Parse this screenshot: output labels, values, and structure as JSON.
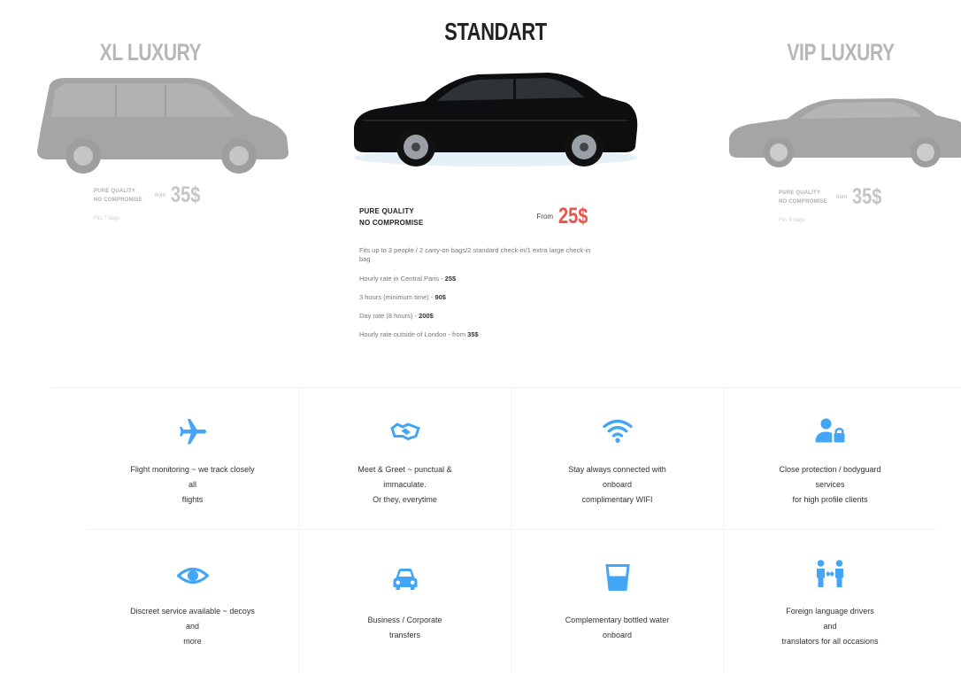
{
  "carousel": {
    "left": {
      "title": "XL LUXURY",
      "quality_line1": "PURE QUALITY",
      "quality_line2": "NO COMPROMISE",
      "from": "from",
      "price": "35$",
      "sub": "Fits 7 bags"
    },
    "center": {
      "title": "STANDART",
      "quality_line1": "PURE QUALITY",
      "quality_line2": "NO COMPROMISE",
      "from": "From",
      "price": "25$",
      "description": "Fits up to 3 people / 2 carry-on bags/2 standard check-in/1 extra large check-in bag",
      "rates": [
        {
          "label": "Hourly rate in Central Paris - ",
          "value": "25$"
        },
        {
          "label": "3 hours (minimum time) - ",
          "value": "90$"
        },
        {
          "label": "Day rate (8 hours) - ",
          "value": "200$"
        },
        {
          "label": "Hourly rate outside of London - from ",
          "value": "35$"
        }
      ]
    },
    "right": {
      "title": "VIP LUXURY",
      "quality_line1": "PURE QUALITY",
      "quality_line2": "NO COMPROMISE",
      "from": "from",
      "price": "35$",
      "sub": "Fits 3 bags"
    }
  },
  "features": [
    {
      "icon": "plane-icon",
      "lines": [
        "Flight monitoring ~ we track closely",
        "all",
        "flights"
      ]
    },
    {
      "icon": "handshake-icon",
      "lines": [
        "Meet & Greet ~ punctual &",
        "immaculate.",
        "Or they, everytime"
      ]
    },
    {
      "icon": "wifi-icon",
      "lines": [
        "Stay always connected with",
        "onboard",
        "complimentary WIFI"
      ]
    },
    {
      "icon": "bodyguard-icon",
      "lines": [
        "Close protection / bodyguard",
        "services",
        "for high profile clients"
      ]
    },
    {
      "icon": "eye-icon",
      "lines": [
        "Discreet service available ~ decoys",
        "and",
        "more"
      ]
    },
    {
      "icon": "car-icon",
      "lines": [
        "Business / Corporate",
        "transfers"
      ]
    },
    {
      "icon": "water-glass-icon",
      "lines": [
        "Complementary bottled water",
        "onboard"
      ]
    },
    {
      "icon": "translator-icon",
      "lines": [
        "Foreign language drivers",
        "and",
        "translators for all occasions"
      ]
    }
  ],
  "colors": {
    "accent": "#42a5f5",
    "price_red": "#e8554e"
  }
}
